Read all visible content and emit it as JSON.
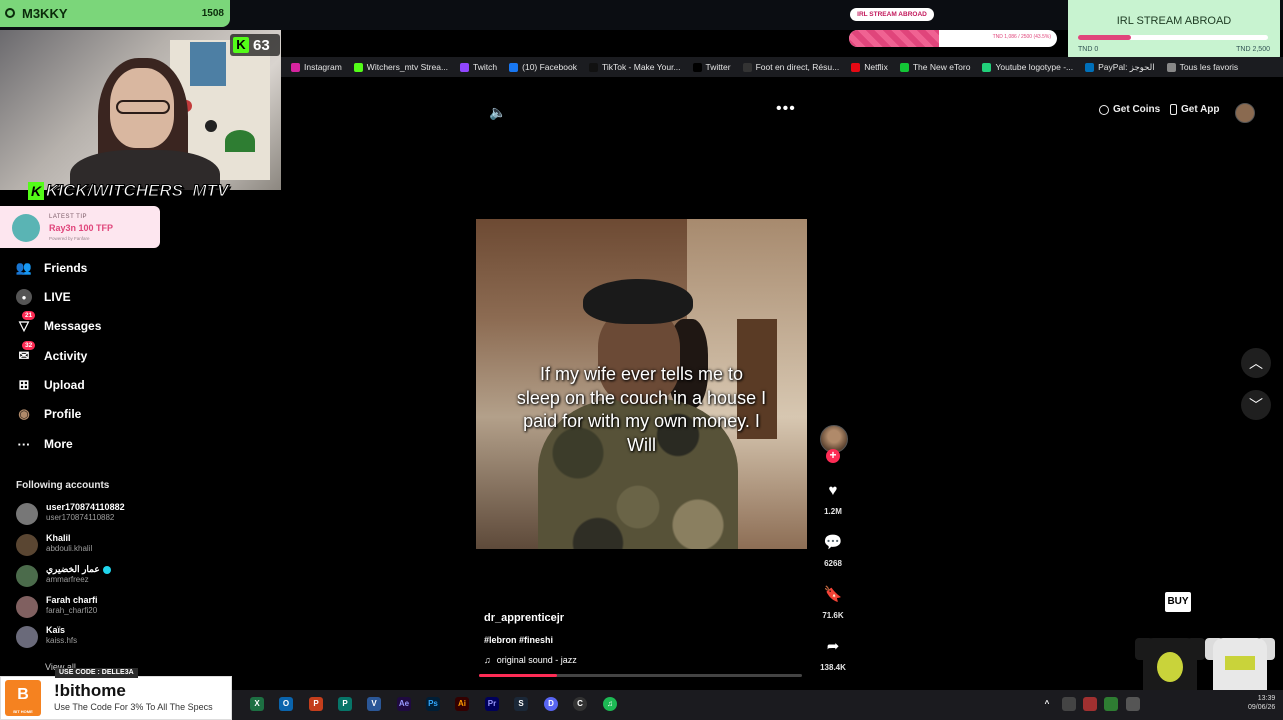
{
  "stream": {
    "channel_name": "M3KKY",
    "channel_count": "1508",
    "kick_viewers": "63",
    "kick_handle": "KICK/WITCHERS_MTV",
    "kick_logo_letter": "K",
    "latest_tip_label": "LATEST TIP",
    "latest_tip_value": "Ray3n 100 TFP",
    "latest_tip_powered": "Powered by Fanfare",
    "goal_pill": "IRL STREAM ABROAD",
    "goal_bar_text": "TND 1,086 / 2500 (43.5%)",
    "goal_title": "IRL STREAM ABROAD",
    "goal_low": "TND 0",
    "goal_high": "TND 2,500",
    "goal_fill_fraction": 0.28,
    "goal_bar_fraction": 0.435
  },
  "bookmarks": [
    {
      "label": "Instagram",
      "color": "#d6249f"
    },
    {
      "label": "Witchers_mtv Strea...",
      "color": "#53fc18"
    },
    {
      "label": "Twitch",
      "color": "#9146ff"
    },
    {
      "label": "(10) Facebook",
      "color": "#1877f2"
    },
    {
      "label": "TikTok - Make Your...",
      "color": "#111111"
    },
    {
      "label": "Twitter",
      "color": "#000000"
    },
    {
      "label": "Foot en direct, Résu...",
      "color": "#333333"
    },
    {
      "label": "Netflix",
      "color": "#e50914"
    },
    {
      "label": "The New eToro",
      "color": "#13c636"
    },
    {
      "label": "Youtube logotype -...",
      "color": "#21d07a"
    },
    {
      "label": "PayPal: الحوجز",
      "color": "#0070ba"
    },
    {
      "label": "Tous les favoris",
      "color": "#888888"
    }
  ],
  "sidebar": {
    "items": [
      {
        "label": "Friends",
        "icon": "friends-icon",
        "glyph": "👥"
      },
      {
        "label": "LIVE",
        "icon": "live-icon",
        "glyph": "●"
      },
      {
        "label": "Messages",
        "icon": "messages-icon",
        "glyph": "▽",
        "badge": "21"
      },
      {
        "label": "Activity",
        "icon": "activity-icon",
        "glyph": "✉",
        "badge": "32"
      },
      {
        "label": "Upload",
        "icon": "upload-icon",
        "glyph": "⊞"
      },
      {
        "label": "Profile",
        "icon": "profile-icon",
        "glyph": "◉"
      },
      {
        "label": "More",
        "icon": "more-icon",
        "glyph": "···"
      }
    ],
    "following_title": "Following accounts",
    "accounts": [
      {
        "name": "user170874110882",
        "handle": "user170874110882",
        "color": "#777777"
      },
      {
        "name": "Khalil",
        "handle": "abdouli.khalil",
        "color": "#5a4632"
      },
      {
        "name": "عمار الخضيري",
        "handle": "ammarfreez",
        "color": "#4b6b4b",
        "verified": true
      },
      {
        "name": "Farah charfi",
        "handle": "farah_charfi20",
        "color": "#806060"
      },
      {
        "name": "Kaïs",
        "handle": "kaiss.hfs",
        "color": "#6a6a7a"
      }
    ],
    "view_all": "View all"
  },
  "promo": {
    "use_code": "USE CODE : DELLE3A",
    "command": "!bithome",
    "subtitle": "Use The Code For 3% To All The Specs",
    "logo_text": "BIT HOME"
  },
  "video": {
    "caption": "If my wife ever tells me to sleep on the couch in a house I paid for with my own money. I Will",
    "username": "dr_apprenticejr",
    "hashtags": "#lebron #fineshi",
    "sound": "original sound - jazz",
    "progress_fraction": 0.24,
    "likes": "1.2M",
    "comments": "6268",
    "saves": "71.6K",
    "shares": "138.4K"
  },
  "header": {
    "get_coins": "Get Coins",
    "get_app": "Get App"
  },
  "merch": {
    "buy_label": "BUY"
  },
  "taskbar": {
    "time": "13:39",
    "date": "09/06/26"
  }
}
